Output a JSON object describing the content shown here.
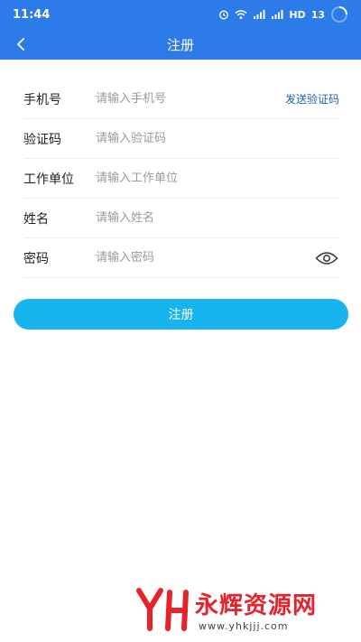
{
  "status_bar": {
    "time": "11:44",
    "network": "HD",
    "battery": "13"
  },
  "header": {
    "title": "注册"
  },
  "form": {
    "phone": {
      "label": "手机号",
      "placeholder": "请输入手机号",
      "action": "发送验证码"
    },
    "code": {
      "label": "验证码",
      "placeholder": "请输入验证码"
    },
    "company": {
      "label": "工作单位",
      "placeholder": "请输入工作单位"
    },
    "name": {
      "label": "姓名",
      "placeholder": "请输入姓名"
    },
    "password": {
      "label": "密码",
      "placeholder": "请输入密码"
    }
  },
  "submit": {
    "label": "注册"
  },
  "watermark": {
    "text": "永辉资源网",
    "url": "www.yhkjjj.com"
  },
  "colors": {
    "header_bg": "#2d7be8",
    "button_bg": "#17b4ee",
    "link": "#1e63b8",
    "watermark_red": "#e5232a"
  },
  "icons": {
    "back": "chevron-left-icon",
    "password_toggle": "eye-icon",
    "alarm": "alarm-icon",
    "wifi": "wifi-icon",
    "signal": "signal-icon",
    "loading": "loading-spinner-icon"
  }
}
